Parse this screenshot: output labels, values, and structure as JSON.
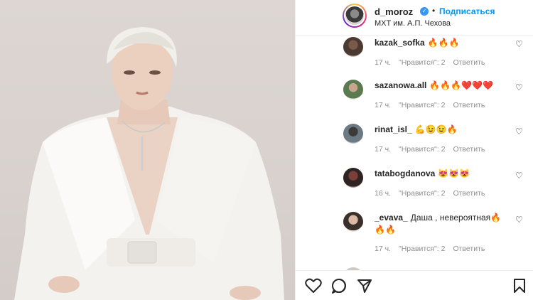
{
  "header": {
    "username": "d_moroz",
    "verified_mark": "✓",
    "separator": "•",
    "follow_label": "Подписаться",
    "location": "МХТ им. А.П. Чехова"
  },
  "comments": [
    {
      "username": "kazak_sofka",
      "text": "🔥🔥🔥",
      "time": "17 ч.",
      "likes": "\"Нравится\": 2",
      "reply": "Ответить"
    },
    {
      "username": "sazanowa.all",
      "text": "🔥🔥🔥❤️❤️❤️",
      "time": "17 ч.",
      "likes": "\"Нравится\": 2",
      "reply": "Ответить"
    },
    {
      "username": "rinat_isl_",
      "text": "💪😉😉🔥",
      "time": "17 ч.",
      "likes": "\"Нравится\": 2",
      "reply": "Ответить"
    },
    {
      "username": "tatabogdanova",
      "text": "😻😻😻",
      "time": "16 ч.",
      "likes": "\"Нравится\": 2",
      "reply": "Ответить"
    },
    {
      "username": "_evava_",
      "text": "Даша , невероятная🔥🔥🔥",
      "time": "17 ч.",
      "likes": "\"Нравится\": 2",
      "reply": "Ответить"
    }
  ],
  "icons": {
    "like": "heart-icon",
    "comment": "comment-icon",
    "share": "share-icon",
    "save": "bookmark-icon"
  },
  "colors": {
    "accent": "#0095f6",
    "verified": "#3897f0",
    "meta_text": "#8e8e8e"
  }
}
